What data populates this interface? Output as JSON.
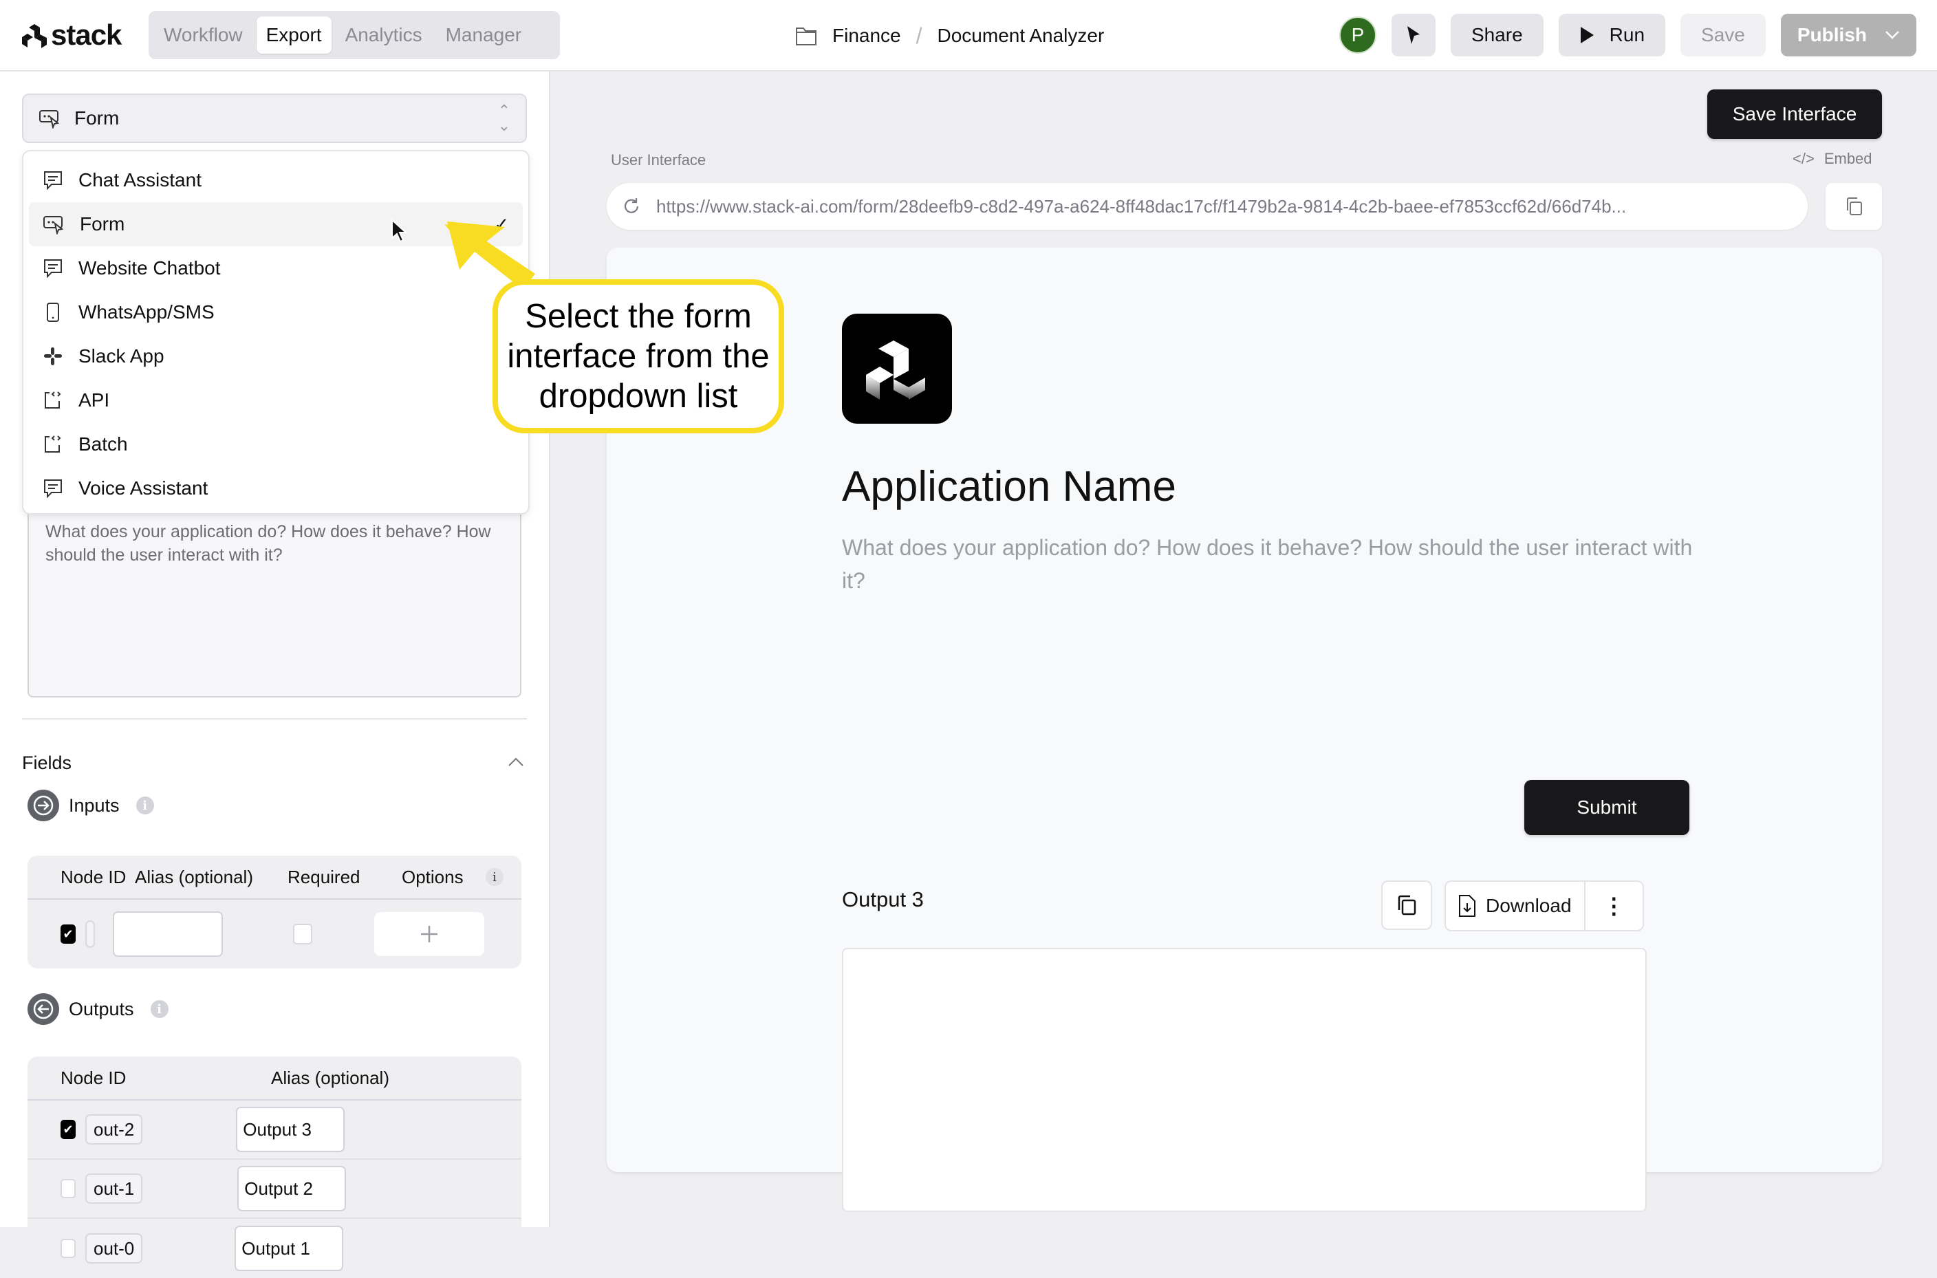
{
  "header": {
    "brand": "stack",
    "tabs": [
      {
        "label": "Workflow",
        "active": false
      },
      {
        "label": "Export",
        "active": true
      },
      {
        "label": "Analytics",
        "active": false
      },
      {
        "label": "Manager",
        "active": false
      }
    ],
    "breadcrumb": {
      "folder": "Finance",
      "separator": "/",
      "project": "Document Analyzer"
    },
    "avatar_initial": "P",
    "share_label": "Share",
    "run_label": "Run",
    "save_label": "Save",
    "publish_label": "Publish"
  },
  "sidebar": {
    "interface_select": {
      "value": "Form"
    },
    "dropdown_options": [
      {
        "label": "Chat Assistant",
        "icon": "chat-icon",
        "selected": false
      },
      {
        "label": "Form",
        "icon": "form-icon",
        "selected": true
      },
      {
        "label": "Website Chatbot",
        "icon": "chat-icon",
        "selected": false
      },
      {
        "label": "WhatsApp/SMS",
        "icon": "phone-icon",
        "selected": false
      },
      {
        "label": "Slack App",
        "icon": "slack-icon",
        "selected": false
      },
      {
        "label": "API",
        "icon": "api-icon",
        "selected": false
      },
      {
        "label": "Batch",
        "icon": "api-icon",
        "selected": false
      },
      {
        "label": "Voice Assistant",
        "icon": "chat-icon",
        "selected": false
      }
    ],
    "check_mark": "✓",
    "description_placeholder": "What does your application do? How does it behave? How should the user interact with it?",
    "fields_title": "Fields",
    "inputs": {
      "title": "Inputs",
      "columns": [
        "Node ID",
        "Alias (optional)",
        "Required",
        "Options"
      ],
      "options_info": "i",
      "rows": [
        {
          "checked": true,
          "node_id": "",
          "alias": "",
          "required": false
        }
      ]
    },
    "outputs": {
      "title": "Outputs",
      "columns": [
        "Node ID",
        "Alias (optional)"
      ],
      "rows": [
        {
          "checked": true,
          "node_id": "out-2",
          "alias": "Output 3"
        },
        {
          "checked": false,
          "node_id": "out-1",
          "alias": "Output 2"
        },
        {
          "checked": false,
          "node_id": "out-0",
          "alias": "Output 1"
        }
      ]
    }
  },
  "main": {
    "save_interface_label": "Save Interface",
    "user_interface_label": "User Interface",
    "embed_label": "Embed",
    "url": "https://www.stack-ai.com/form/28deefb9-c8d2-497a-a624-8ff48dac17cf/f1479b2a-9814-4c2b-baee-ef7853ccf62d/66d74b...",
    "preview": {
      "app_name": "Application Name",
      "app_description": "What does your application do? How does it behave? How should the user interact with it?",
      "submit_label": "Submit",
      "output_title": "Output 3",
      "download_label": "Download"
    }
  },
  "annotation": {
    "callout_text": "Select the form interface from the dropdown list",
    "color": "#f8dc22"
  }
}
